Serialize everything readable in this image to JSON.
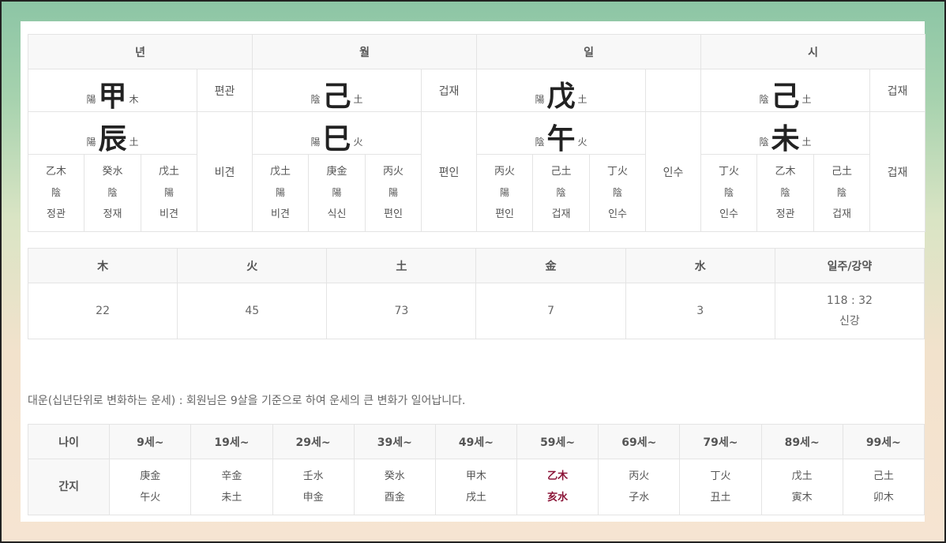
{
  "pillars": [
    {
      "header": "년",
      "stem": {
        "yinyang": "陽",
        "char": "甲",
        "element": "木",
        "god": "편관"
      },
      "branch": {
        "yinyang": "陽",
        "char": "辰",
        "element": "土",
        "god": "비견"
      },
      "hidden": [
        {
          "stem": "乙木",
          "yinyang": "陰",
          "god": "정관"
        },
        {
          "stem": "癸水",
          "yinyang": "陰",
          "god": "정재"
        },
        {
          "stem": "戊土",
          "yinyang": "陽",
          "god": "비견"
        }
      ]
    },
    {
      "header": "월",
      "stem": {
        "yinyang": "陰",
        "char": "己",
        "element": "土",
        "god": "겁재"
      },
      "branch": {
        "yinyang": "陽",
        "char": "巳",
        "element": "火",
        "god": "편인"
      },
      "hidden": [
        {
          "stem": "戊土",
          "yinyang": "陽",
          "god": "비견"
        },
        {
          "stem": "庚金",
          "yinyang": "陽",
          "god": "식신"
        },
        {
          "stem": "丙火",
          "yinyang": "陽",
          "god": "편인"
        }
      ]
    },
    {
      "header": "일",
      "stem": {
        "yinyang": "陽",
        "char": "戊",
        "element": "土",
        "god": ""
      },
      "branch": {
        "yinyang": "陰",
        "char": "午",
        "element": "火",
        "god": "인수"
      },
      "hidden": [
        {
          "stem": "丙火",
          "yinyang": "陽",
          "god": "편인"
        },
        {
          "stem": "己土",
          "yinyang": "陰",
          "god": "겁재"
        },
        {
          "stem": "丁火",
          "yinyang": "陰",
          "god": "인수"
        }
      ]
    },
    {
      "header": "시",
      "stem": {
        "yinyang": "陰",
        "char": "己",
        "element": "土",
        "god": "겁재"
      },
      "branch": {
        "yinyang": "陰",
        "char": "未",
        "element": "土",
        "god": "겁재"
      },
      "hidden": [
        {
          "stem": "丁火",
          "yinyang": "陰",
          "god": "인수"
        },
        {
          "stem": "乙木",
          "yinyang": "陰",
          "god": "정관"
        },
        {
          "stem": "己土",
          "yinyang": "陰",
          "god": "겁재"
        }
      ]
    }
  ],
  "ohaeng": {
    "headers": [
      "木",
      "火",
      "土",
      "金",
      "水",
      "일주/강약"
    ],
    "values": [
      "22",
      "45",
      "73",
      "7",
      "3"
    ],
    "strength_ratio": "118 : 32",
    "strength_label": "신강"
  },
  "daewoon": {
    "description": "대운(십년단위로 변화하는 운세) : 회원님은 9살을 기준으로 하여 운세의 큰 변화가 일어납니다.",
    "age_label": "나이",
    "ganji_label": "간지",
    "highlight_color": "#8b1538",
    "columns": [
      {
        "age": "9세~",
        "stem": "庚金",
        "branch": "午火",
        "current": false
      },
      {
        "age": "19세~",
        "stem": "辛金",
        "branch": "未土",
        "current": false
      },
      {
        "age": "29세~",
        "stem": "壬水",
        "branch": "申金",
        "current": false
      },
      {
        "age": "39세~",
        "stem": "癸水",
        "branch": "酉金",
        "current": false
      },
      {
        "age": "49세~",
        "stem": "甲木",
        "branch": "戌土",
        "current": false
      },
      {
        "age": "59세~",
        "stem": "乙木",
        "branch": "亥水",
        "current": true
      },
      {
        "age": "69세~",
        "stem": "丙火",
        "branch": "子水",
        "current": false
      },
      {
        "age": "79세~",
        "stem": "丁火",
        "branch": "丑土",
        "current": false
      },
      {
        "age": "89세~",
        "stem": "戊土",
        "branch": "寅木",
        "current": false
      },
      {
        "age": "99세~",
        "stem": "己土",
        "branch": "卯木",
        "current": false
      }
    ]
  }
}
